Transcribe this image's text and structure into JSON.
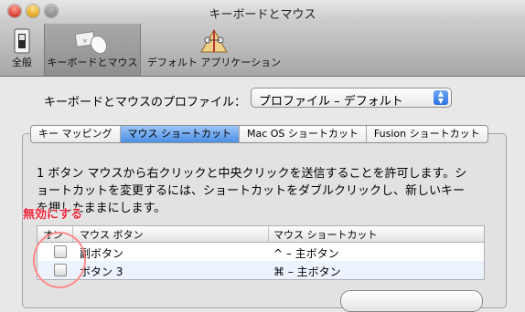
{
  "window": {
    "title": "キーボードとマウス"
  },
  "toolbar": {
    "items": [
      {
        "label": "全般",
        "icon": "switch-icon"
      },
      {
        "label": "キーボードとマウス",
        "icon": "keyboard-mouse-icon",
        "selected": true
      },
      {
        "label": "デフォルト アプリケーション",
        "icon": "default-apps-icon"
      }
    ]
  },
  "profile": {
    "label": "キーボードとマウスのプロファイル：",
    "selected": "プロファイル – デフォルト"
  },
  "tabs": [
    {
      "label": "キー マッピング"
    },
    {
      "label": "マウス ショートカット",
      "active": true
    },
    {
      "label": "Mac OS ショートカット"
    },
    {
      "label": "Fusion ショートカット"
    }
  ],
  "description": "1 ボタン マウスから右クリックと中央クリックを送信することを許可します。ショートカットを変更するには、ショートカットをダブルクリックし、新しいキーを押したままにします。",
  "table": {
    "headers": [
      "オン",
      "マウス ボタン",
      "マウス ショートカット"
    ],
    "rows": [
      {
        "on": false,
        "button": "副ボタン",
        "shortcut": "^ – 主ボタン"
      },
      {
        "on": false,
        "button": "ボタン 3",
        "shortcut": "⌘ – 主ボタン"
      }
    ]
  },
  "annotation": {
    "label": "無効にする",
    "color": "#e8263a"
  }
}
